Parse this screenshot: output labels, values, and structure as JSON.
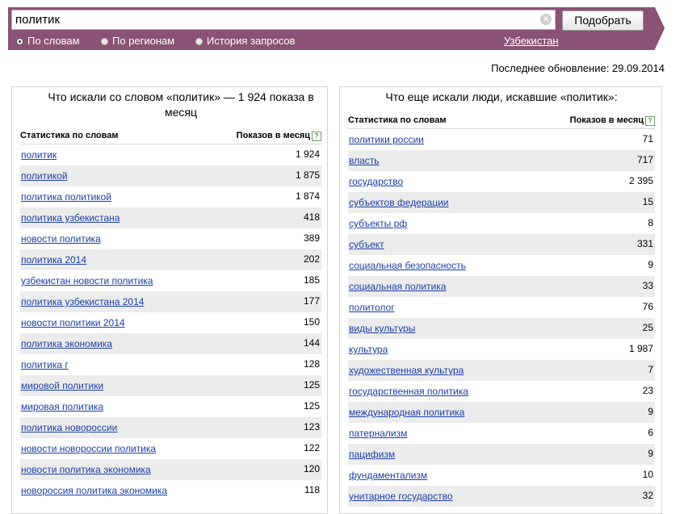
{
  "search": {
    "value": "политик",
    "button_label": "Подобрать"
  },
  "options": [
    "По словам",
    "По регионам",
    "История запросов"
  ],
  "region": "Узбекистан",
  "updated": "Последнее обновление: 29.09.2014",
  "left": {
    "title": "Что искали со словом «политик» — 1 924 показа в месяц",
    "col1": "Статистика по словам",
    "col2": "Показов в месяц",
    "rows": [
      {
        "phrase": "политик",
        "count": "1 924"
      },
      {
        "phrase": "политикой",
        "count": "1 875"
      },
      {
        "phrase": "политика политикой",
        "count": "1 874"
      },
      {
        "phrase": "политика узбекистана",
        "count": "418"
      },
      {
        "phrase": "новости политика",
        "count": "389"
      },
      {
        "phrase": "политика 2014",
        "count": "202"
      },
      {
        "phrase": "узбекистан новости политика",
        "count": "185"
      },
      {
        "phrase": "политика узбекистана 2014",
        "count": "177"
      },
      {
        "phrase": "новости политики 2014",
        "count": "150"
      },
      {
        "phrase": "политика экономика",
        "count": "144"
      },
      {
        "phrase": "политика г",
        "count": "128"
      },
      {
        "phrase": "мировой политики",
        "count": "125"
      },
      {
        "phrase": "мировая политика",
        "count": "125"
      },
      {
        "phrase": "политика новороссии",
        "count": "123"
      },
      {
        "phrase": "новости новороссии политика",
        "count": "122"
      },
      {
        "phrase": "новости политика экономика",
        "count": "120"
      },
      {
        "phrase": "новороссия политика экономика",
        "count": "118"
      }
    ]
  },
  "right": {
    "title": "Что еще искали люди, искавшие «политик»:",
    "col1": "Статистика по словам",
    "col2": "Показов в месяц",
    "rows": [
      {
        "phrase": "политики россии",
        "count": "71"
      },
      {
        "phrase": "власть",
        "count": "717"
      },
      {
        "phrase": "государство",
        "count": "2 395"
      },
      {
        "phrase": "субъектов федерации",
        "count": "15"
      },
      {
        "phrase": "субъекты рф",
        "count": "8"
      },
      {
        "phrase": "субъект",
        "count": "331"
      },
      {
        "phrase": "социальная безопасность",
        "count": "9"
      },
      {
        "phrase": "социальная политика",
        "count": "33"
      },
      {
        "phrase": "политолог",
        "count": "76"
      },
      {
        "phrase": "виды культуры",
        "count": "25"
      },
      {
        "phrase": "культура",
        "count": "1 987"
      },
      {
        "phrase": "художественная культура",
        "count": "7"
      },
      {
        "phrase": "государственная политика",
        "count": "23"
      },
      {
        "phrase": "международная политика",
        "count": "9"
      },
      {
        "phrase": "патернализм",
        "count": "6"
      },
      {
        "phrase": "пацифизм",
        "count": "9"
      },
      {
        "phrase": "фундаментализм",
        "count": "10"
      },
      {
        "phrase": "унитарное государство",
        "count": "32"
      }
    ]
  },
  "colors": {
    "bar": "#8a5274",
    "link": "#1a3ea8",
    "row_alt": "#ececec"
  },
  "icons": {
    "clear": "close-icon",
    "help": "question-icon"
  }
}
